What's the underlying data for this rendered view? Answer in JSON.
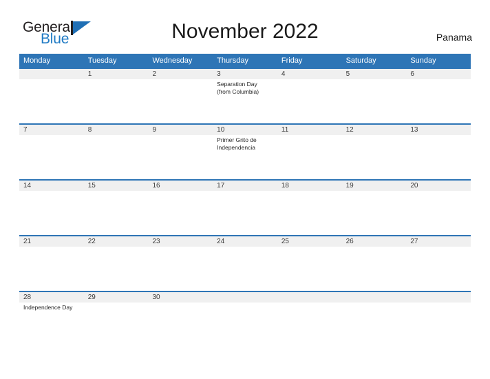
{
  "brand": {
    "name_part1": "General",
    "name_part2": "Blue"
  },
  "header": {
    "title": "November 2022",
    "region": "Panama"
  },
  "calendar": {
    "weekdays": [
      "Monday",
      "Tuesday",
      "Wednesday",
      "Thursday",
      "Friday",
      "Saturday",
      "Sunday"
    ],
    "accent_color": "#2e75b6",
    "band_color": "#f0f0f0",
    "weeks": [
      [
        {
          "day": "",
          "events": []
        },
        {
          "day": "1",
          "events": []
        },
        {
          "day": "2",
          "events": []
        },
        {
          "day": "3",
          "events": [
            "Separation Day",
            "(from Columbia)"
          ]
        },
        {
          "day": "4",
          "events": []
        },
        {
          "day": "5",
          "events": []
        },
        {
          "day": "6",
          "events": []
        }
      ],
      [
        {
          "day": "7",
          "events": []
        },
        {
          "day": "8",
          "events": []
        },
        {
          "day": "9",
          "events": []
        },
        {
          "day": "10",
          "events": [
            "Primer Grito de",
            "Independencia"
          ]
        },
        {
          "day": "11",
          "events": []
        },
        {
          "day": "12",
          "events": []
        },
        {
          "day": "13",
          "events": []
        }
      ],
      [
        {
          "day": "14",
          "events": []
        },
        {
          "day": "15",
          "events": []
        },
        {
          "day": "16",
          "events": []
        },
        {
          "day": "17",
          "events": []
        },
        {
          "day": "18",
          "events": []
        },
        {
          "day": "19",
          "events": []
        },
        {
          "day": "20",
          "events": []
        }
      ],
      [
        {
          "day": "21",
          "events": []
        },
        {
          "day": "22",
          "events": []
        },
        {
          "day": "23",
          "events": []
        },
        {
          "day": "24",
          "events": []
        },
        {
          "day": "25",
          "events": []
        },
        {
          "day": "26",
          "events": []
        },
        {
          "day": "27",
          "events": []
        }
      ],
      [
        {
          "day": "28",
          "events": [
            "Independence Day"
          ]
        },
        {
          "day": "29",
          "events": []
        },
        {
          "day": "30",
          "events": []
        },
        {
          "day": "",
          "events": []
        },
        {
          "day": "",
          "events": []
        },
        {
          "day": "",
          "events": []
        },
        {
          "day": "",
          "events": []
        }
      ]
    ]
  }
}
